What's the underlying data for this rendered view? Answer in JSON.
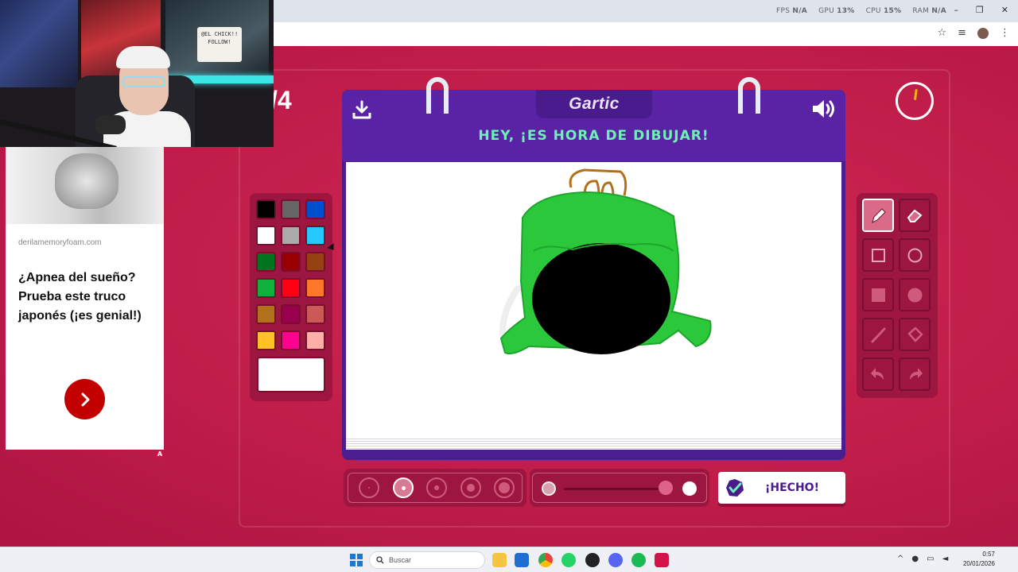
{
  "browser": {
    "sysstats": [
      {
        "label": "FPS",
        "value": "N/A"
      },
      {
        "label": "GPU",
        "value": "13%"
      },
      {
        "label": "CPU",
        "value": "15%"
      },
      {
        "label": "RAM",
        "value": "N/A"
      }
    ],
    "window_controls": [
      "–",
      "❐",
      "✕"
    ]
  },
  "game": {
    "logo": "Gartic",
    "round": "/4",
    "prompt": "HEY, ¡ES HORA DE DIBUJAR!",
    "done_label": "¡HECHO!",
    "timer_remaining_fraction": 0.98,
    "colors": {
      "background": "#c61d4a",
      "board": "#5a23a6",
      "prompt_text": "#6ff0b6",
      "selected_color": "#ffffff"
    },
    "palette": [
      "#000000",
      "#666666",
      "#0050cd",
      "#ffffff",
      "#aaaaaa",
      "#26c9ff",
      "#017420",
      "#990000",
      "#964112",
      "#11b03c",
      "#ff0013",
      "#ff7829",
      "#b0701c",
      "#99004e",
      "#cb5a57",
      "#ffc126",
      "#ff008f",
      "#feafa8"
    ],
    "tools": [
      {
        "name": "pencil-icon",
        "active": true
      },
      {
        "name": "eraser-icon",
        "active": false
      },
      {
        "name": "rectangle-outline-icon",
        "active": false
      },
      {
        "name": "ellipse-outline-icon",
        "active": false
      },
      {
        "name": "rectangle-filled-icon",
        "active": false
      },
      {
        "name": "ellipse-filled-icon",
        "active": false
      },
      {
        "name": "line-icon",
        "active": false
      },
      {
        "name": "fill-bucket-icon",
        "active": false
      },
      {
        "name": "undo-icon",
        "active": false
      },
      {
        "name": "redo-icon",
        "active": false
      }
    ],
    "brush_sizes_selected_index": 1,
    "opacity_level": 0.95
  },
  "webcam": {
    "sign_text": "@EL CHICK!! FOLLOW!"
  },
  "ad": {
    "domain": "derilamemoryfoam.com",
    "headline": "¿Apnea del sueño? Prueba este truco japonés (¡es genial!)",
    "badge": "A"
  },
  "taskbar": {
    "search_placeholder": "Buscar",
    "time": "0:57",
    "date": "20/01/2026"
  }
}
